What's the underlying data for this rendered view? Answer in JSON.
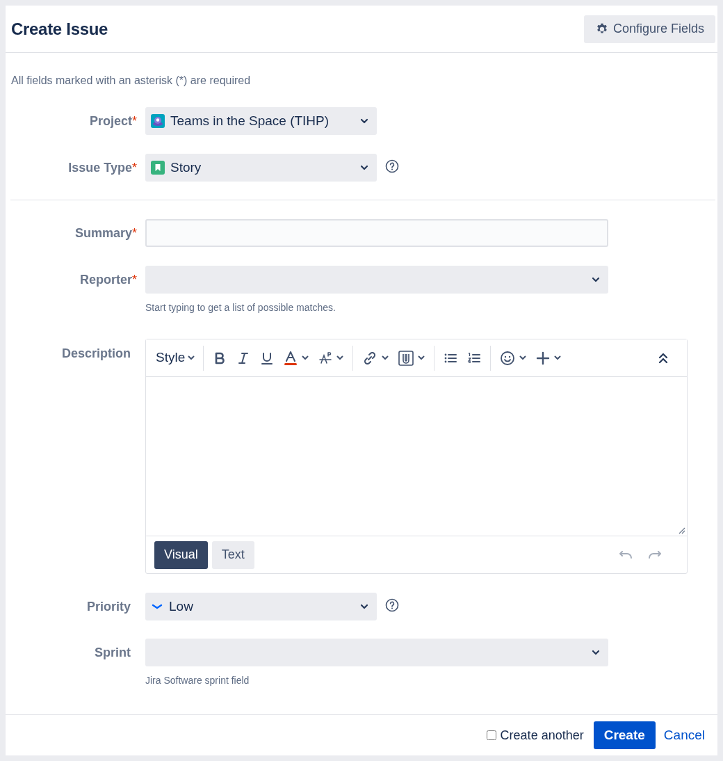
{
  "dialog": {
    "title": "Create Issue",
    "configure_button": "Configure Fields"
  },
  "required_note": "All fields marked with an asterisk (*) are required",
  "fields": [
    {
      "kind": "select",
      "label": "Project",
      "required_mark": "*",
      "value": "Teams in the Space (TIHP)"
    },
    {
      "kind": "select",
      "label": "Issue Type",
      "required_mark": "*",
      "value": "Story"
    },
    {
      "kind": "text",
      "label": "Summary",
      "required_mark": "*"
    },
    {
      "kind": "select",
      "label": "Reporter",
      "required_mark": "*",
      "hint": "Start typing to get a list of possible matches."
    },
    {
      "kind": "editor",
      "label": "Description",
      "style_label": "Style",
      "tabs": [
        {
          "label": "Visual",
          "selected": true
        },
        {
          "label": "Text",
          "selected": false
        }
      ],
      "undo_disabled": true
    },
    {
      "kind": "select",
      "label": "Priority",
      "value": "Low"
    },
    {
      "kind": "select",
      "label": "Sprint",
      "hint": "Jira Software sprint field"
    }
  ],
  "footer": {
    "create_another": {
      "label": "Create another",
      "checked": false
    },
    "create_button": "Create",
    "cancel_link": "Cancel"
  }
}
